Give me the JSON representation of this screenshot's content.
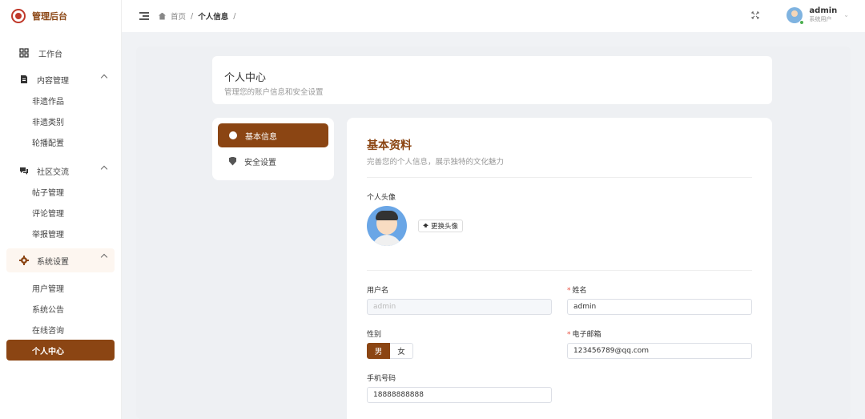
{
  "brand": {
    "title": "管理后台"
  },
  "sidebar": {
    "workbench": "工作台",
    "groups": [
      {
        "label": "内容管理",
        "items": [
          "非遗作品",
          "非遗类别",
          "轮播配置"
        ]
      },
      {
        "label": "社区交流",
        "items": [
          "帖子管理",
          "评论管理",
          "举报管理"
        ]
      },
      {
        "label": "系统设置",
        "items": [
          "用户管理",
          "系统公告",
          "在线咨询",
          "个人中心"
        ]
      }
    ]
  },
  "header": {
    "breadcrumb": [
      "首页",
      "个人信息"
    ],
    "user": {
      "name": "admin",
      "role": "系统用户"
    }
  },
  "page": {
    "title": "个人中心",
    "subtitle": "管理您的账户信息和安全设置"
  },
  "side_menu": [
    "基本信息",
    "安全设置"
  ],
  "profile": {
    "title": "基本资料",
    "subtitle": "完善您的个人信息，展示独特的文化魅力",
    "avatar_label": "个人头像",
    "change_avatar": "更换头像",
    "username_label": "用户名",
    "username_value": "admin",
    "name_label": "姓名",
    "name_value": "admin",
    "gender_label": "性别",
    "gender_options": [
      "男",
      "女"
    ],
    "gender_selected": "男",
    "email_label": "电子邮箱",
    "email_value": "123456789@qq.com",
    "phone_label": "手机号码",
    "phone_value": "18888888888"
  },
  "colors": {
    "accent": "#8b4513",
    "required": "#e74c3c"
  }
}
